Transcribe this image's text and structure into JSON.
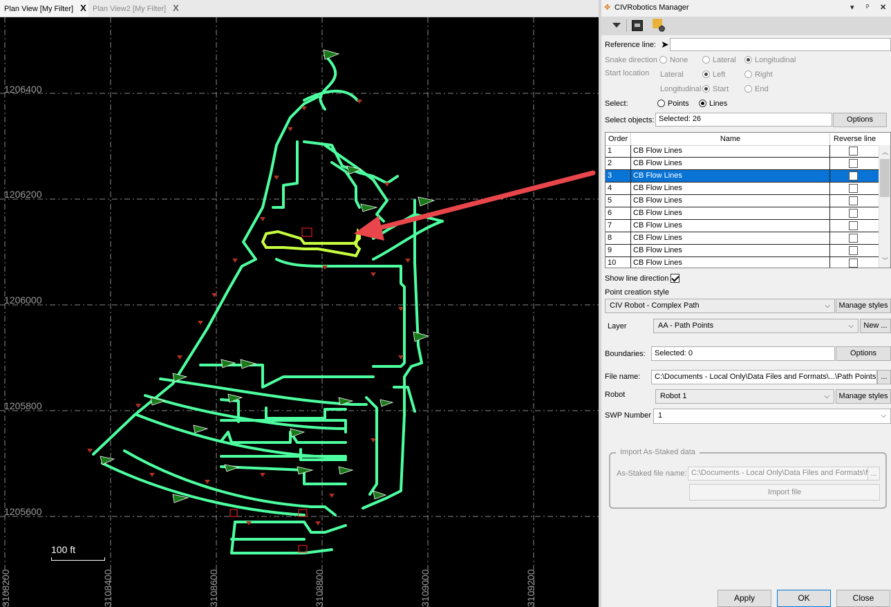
{
  "view_tabs": [
    {
      "label": "Plan View [My Filter]",
      "close": "X"
    },
    {
      "label": "Plan View2 [My Filter]",
      "close": "X"
    }
  ],
  "canvas": {
    "y_labels": [
      "1206400",
      "1206200",
      "1206000",
      "1205800",
      "1205600"
    ],
    "x_labels": [
      "3108200",
      "3108400",
      "3108600",
      "3108800",
      "3109000",
      "3109200"
    ],
    "scale_label": "100 ft",
    "colors": {
      "path": "#4dffa0",
      "highlight": "#c8ff40",
      "arrow": "#e8464b",
      "flag": "#1a6e1a",
      "grid": "#8a8a8a"
    }
  },
  "panel": {
    "title": "CIVRobotics Manager",
    "title_buttons": [
      "▾",
      "ᵖ",
      "✕"
    ],
    "reference_line": {
      "label": "Reference line:",
      "value": ""
    },
    "snake_direction": {
      "label": "Snake direction",
      "options": [
        "None",
        "Lateral",
        "Longitudinal"
      ]
    },
    "start_location": {
      "label": "Start location",
      "lateral": {
        "label": "Lateral",
        "options": [
          "Left",
          "Right"
        ]
      },
      "longitudinal": {
        "label": "Longitudinal",
        "options": [
          "Start",
          "End"
        ]
      }
    },
    "select": {
      "label": "Select:",
      "options": [
        "Points",
        "Lines"
      ]
    },
    "select_objects": {
      "label": "Select objects:",
      "value": "Selected: 26",
      "button": "Options"
    },
    "grid": {
      "headers": [
        "Order",
        "Name",
        "Reverse line"
      ],
      "rows": [
        {
          "order": "1",
          "name": "CB Flow Lines"
        },
        {
          "order": "2",
          "name": "CB Flow Lines"
        },
        {
          "order": "3",
          "name": "CB Flow Lines"
        },
        {
          "order": "4",
          "name": "CB Flow Lines"
        },
        {
          "order": "5",
          "name": "CB Flow Lines"
        },
        {
          "order": "6",
          "name": "CB Flow Lines"
        },
        {
          "order": "7",
          "name": "CB Flow Lines"
        },
        {
          "order": "8",
          "name": "CB Flow Lines"
        },
        {
          "order": "9",
          "name": "CB Flow Lines"
        },
        {
          "order": "10",
          "name": "CB Flow Lines"
        }
      ]
    },
    "show_line_direction": {
      "label": "Show line direction"
    },
    "point_creation_style": {
      "label": "Point creation style",
      "value": "CIV Robot - Complex Path",
      "button": "Manage styles"
    },
    "layer": {
      "label": "Layer",
      "value": "AA - Path Points",
      "button": "New ..."
    },
    "boundaries": {
      "label": "Boundaries:",
      "value": "Selected: 0",
      "button": "Options"
    },
    "file_name": {
      "label": "File name:",
      "value": "C:\\Documents - Local Only\\Data Files and Formats\\...\\Path Points.cs",
      "button": "..."
    },
    "robot": {
      "label": "Robot",
      "value": "Robot 1",
      "button": "Manage styles"
    },
    "swp_number": {
      "label": "SWP Number",
      "value": "1"
    },
    "import": {
      "legend": "Import As-Staked data",
      "file_label": "As-Staked file name:",
      "file_value": "C:\\Documents - Local Only\\Data Files and Formats\\M",
      "browse": "...",
      "button": "Import file"
    },
    "footer": {
      "apply": "Apply",
      "ok": "OK",
      "close": "Close"
    }
  }
}
